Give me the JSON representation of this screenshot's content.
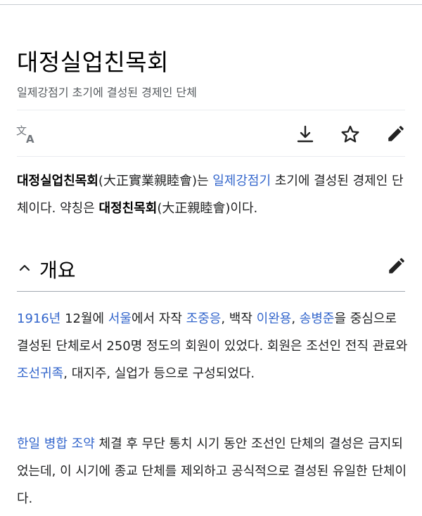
{
  "article": {
    "title": "대정실업친목회",
    "subtitle": "일제강점기 초기에 결성된 경제인 단체"
  },
  "toolbar": {
    "language_icon": "translate-icon",
    "download_icon": "download-icon",
    "watch_icon": "star-icon",
    "edit_icon": "pencil-icon"
  },
  "lead": {
    "t1": "대정실업친목회",
    "t2": "(大正實業親睦會)는 ",
    "l1": "일제강점기",
    "t3": " 초기에 결성된 경제인 단체이다. 약칭은 ",
    "t4": "대정친목회",
    "t5": "(大正親睦會)이다."
  },
  "section": {
    "toggle_icon": "chevron-up-icon",
    "title": "개요",
    "edit_icon": "pencil-icon"
  },
  "p1": {
    "l1": "1916년",
    "t1": " 12월에 ",
    "l2": "서울",
    "t2": "에서 자작 ",
    "l3": "조중응",
    "t3": ", 백작 ",
    "l4": "이완용",
    "t4": ", ",
    "l5": "송병준",
    "t5": "을 중심으로 결성된 단체로서 250명 정도의 회원이 있었다. 회원은 조선인 전직 관료와 ",
    "l6": "조선귀족",
    "t6": ", 대지주, 실업가 등으로 구성되었다."
  },
  "p2": {
    "l1": "한일 병합 조약",
    "t1": " 체결 후 무단 통치 시기 동안 조선인 단체의 결성은 금지되었는데, 이 시기에 종교 단체를 제외하고 공식적으로 결성된 유일한 단체이다."
  },
  "colors": {
    "link": "#3366cc",
    "text": "#202122",
    "subtle": "#54595d"
  }
}
